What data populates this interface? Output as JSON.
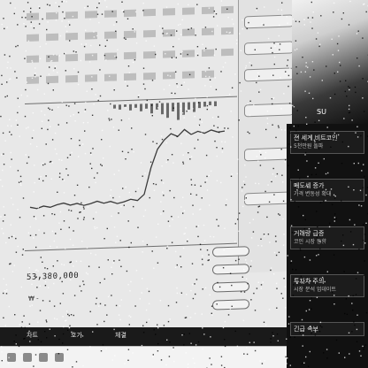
{
  "chart": {
    "line_series": [
      48,
      46,
      49,
      47,
      50,
      52,
      49,
      51,
      48,
      50,
      53,
      50,
      52,
      49,
      51,
      54,
      52,
      60,
      95,
      120,
      132,
      140,
      136,
      145,
      138,
      142,
      139,
      143,
      140,
      141
    ],
    "volume_bars": [
      3,
      4,
      2,
      5,
      3,
      6,
      4,
      8,
      5,
      9,
      12,
      7,
      14,
      10,
      6,
      8,
      5,
      4,
      3,
      4
    ]
  },
  "readouts": {
    "main_price": "53,380,000",
    "small_label": "₩ -"
  },
  "bottom_bar": {
    "tab_1": "차트",
    "tab_2": "호가",
    "tab_3": "체결"
  },
  "news": {
    "header": "SU",
    "block_1": "전 세계 비트코인",
    "block_1_sub": "5천만원 돌파",
    "block_2": "매도세 증가",
    "block_2_sub": "가격 변동성 확대",
    "block_3": "거래량 급증",
    "block_3_sub": "코인 시장 동향",
    "block_4": "투자자 주의",
    "block_4_sub": "시장 분석 업데이트",
    "block_5": "긴급 속보"
  }
}
